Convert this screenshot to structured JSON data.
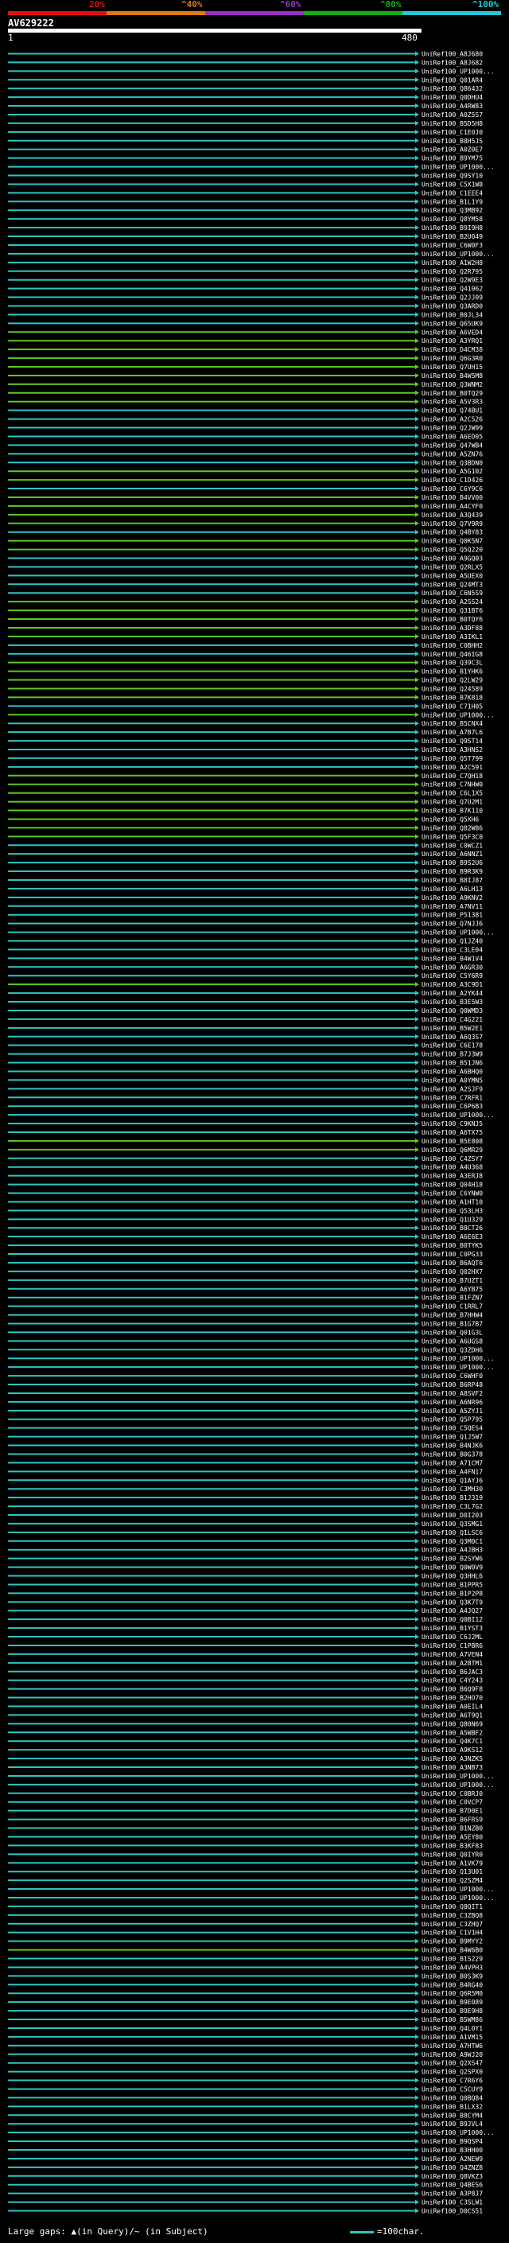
{
  "header": {
    "scale_labels": [
      "20%",
      "^40%",
      "^60%",
      "^80%",
      "^100%"
    ],
    "scale_colors": [
      "#e01010",
      "#e07810",
      "#9a30c8",
      "#10b010",
      "#20c8d8"
    ],
    "query_name": "AV629222",
    "query_start": "1",
    "query_end": "480"
  },
  "footer": {
    "legend_text": "Large gaps: ▲(in Query)/~ (in Subject)",
    "key_text": "=100char."
  },
  "colors": {
    "cyan": "#2ec4c4",
    "green": "#5cc820"
  },
  "chart_data": {
    "type": "alignment-hit-map",
    "query_length": 480,
    "hit_ids": [
      "UniRef100_A8J680",
      "UniRef100_A8J682",
      "UniRef100_UP1000...",
      "UniRef100_Q01AR4",
      "UniRef100_Q86432",
      "UniRef100_Q0DHU4",
      "UniRef100_A4RW83",
      "UniRef100_A0Z5S7",
      "UniRef100_B5D5H8",
      "UniRef100_C1E0J0",
      "UniRef100_B8H5J5",
      "UniRef100_A0Z0E7",
      "UniRef100_B9YM75",
      "UniRef100_UP1000...",
      "UniRef100_Q9SY10",
      "UniRef100_C5X1W8",
      "UniRef100_C1EEE4",
      "UniRef100_B1L1Y9",
      "UniRef100_Q3MB92",
      "UniRef100_Q8YM58",
      "UniRef100_B9I9H8",
      "UniRef100_B2U049",
      "UniRef100_C6W0F3",
      "UniRef100_UP1000...",
      "UniRef100_A1W2H8",
      "UniRef100_Q2R795",
      "UniRef100_Q2W9E3",
      "UniRef100_Q41062",
      "UniRef100_Q2JJ09",
      "UniRef100_Q3ARD0",
      "UniRef100_B0JL34",
      "UniRef100_Q65UK9",
      "UniRef100_A6VED4",
      "UniRef100_A3YRQ1",
      "UniRef100_D4CM38",
      "UniRef100_Q6G3R0",
      "UniRef100_Q7UH15",
      "UniRef100_B4W5M8",
      "UniRef100_Q3WNM2",
      "UniRef100_B0TQ29",
      "UniRef100_A5V3R3",
      "UniRef100_Q74BU1",
      "UniRef100_A2C526",
      "UniRef100_Q2JW99",
      "UniRef100_A6ED05",
      "UniRef100_Q47WB4",
      "UniRef100_A5ZN76",
      "UniRef100_Q3BDN0",
      "UniRef100_A5G102",
      "UniRef100_C1D426",
      "UniRef100_C6Y9C6",
      "UniRef100_B4VV00",
      "UniRef100_A4CYF0",
      "UniRef100_A3Q439",
      "UniRef100_Q7V9R9",
      "UniRef100_Q4BY83",
      "UniRef100_Q0K5N7",
      "UniRef100_Q5Q220",
      "UniRef100_A9GQ03",
      "UniRef100_Q2RLX5",
      "UniRef100_A5UEX0",
      "UniRef100_Q24MT3",
      "UniRef100_C6N5S9",
      "UniRef100_A2SS24",
      "UniRef100_Q31BT6",
      "UniRef100_B0TQY6",
      "UniRef100_A3DF88",
      "UniRef100_A3IKL1",
      "UniRef100_C0BHH2",
      "UniRef100_Q46IG8",
      "UniRef100_Q39C3L",
      "UniRef100_B1YHK6",
      "UniRef100_Q2LW29",
      "UniRef100_Q24589",
      "UniRef100_B7K818",
      "UniRef100_C71H05",
      "UniRef100_UP1000...",
      "UniRef100_B5CNX4",
      "UniRef100_A7B7L6",
      "UniRef100_Q9ST14",
      "UniRef100_A3HNS2",
      "UniRef100_Q5T799",
      "UniRef100_A2C591",
      "UniRef100_C7QH18",
      "UniRef100_C7NHW0",
      "UniRef100_C6L1X5",
      "UniRef100_Q7U2M1",
      "UniRef100_B7K110",
      "UniRef100_Q5XH6",
      "UniRef100_Q82W86",
      "UniRef100_Q5F3C0",
      "UniRef100_C0WCZ1",
      "UniRef100_A6NNZ1",
      "UniRef100_B9S2U6",
      "UniRef100_B9R3K9",
      "UniRef100_B8IJ87",
      "UniRef100_A6LH13",
      "UniRef100_A9KNV2",
      "UniRef100_A7NV11",
      "UniRef100_P51381",
      "UniRef100_Q7NJJ6",
      "UniRef100_UP1000...",
      "UniRef100_Q1JZ40",
      "UniRef100_C3LE04",
      "UniRef100_B4W1V4",
      "UniRef100_A6GR30",
      "UniRef100_C5Y6R9",
      "UniRef100_A3C9D1",
      "UniRef100_A2YK44",
      "UniRef100_B3E5W3",
      "UniRef100_Q0WMD3",
      "UniRef100_C4G221",
      "UniRef100_B5W2E1",
      "UniRef100_A6Q3S7",
      "UniRef100_C6E178",
      "UniRef100_B7J3W9",
      "UniRef100_B51JN6",
      "UniRef100_A6BHQ0",
      "UniRef100_A0YMN5",
      "UniRef100_A2SJF9",
      "UniRef100_C7RFR1",
      "UniRef100_C6P6B3",
      "UniRef100_UP1000...",
      "UniRef100_C9KNJ5",
      "UniRef100_A6TX75",
      "UniRef100_B5E808",
      "UniRef100_Q6MR29",
      "UniRef100_C4ZSY7",
      "UniRef100_A4U368",
      "UniRef100_A3ERJ8",
      "UniRef100_Q04H18",
      "UniRef100_C6YNW0",
      "UniRef100_A1HT10",
      "UniRef100_Q53LH3",
      "UniRef100_Q1U329",
      "UniRef100_B8CT26",
      "UniRef100_A6E6E3",
      "UniRef100_B0TYK5",
      "UniRef100_C0PG33",
      "UniRef100_B6AQT6",
      "UniRef100_Q02HX7",
      "UniRef100_B7UZT1",
      "UniRef100_A6YB75",
      "UniRef100_B1FZN7",
      "UniRef100_C1RRL7",
      "UniRef100_B7HHW4",
      "UniRef100_B1G7B7",
      "UniRef100_Q01G3L",
      "UniRef100_A6UGS8",
      "UniRef100_Q3ZDH6",
      "UniRef100_UP1000...",
      "UniRef100_UP1000...",
      "UniRef100_C6WHF0",
      "UniRef100_B6RP48",
      "UniRef100_A8SVF2",
      "UniRef100_A6NR96",
      "UniRef100_A5ZYJ1",
      "UniRef100_Q5P795",
      "UniRef100_C5QES4",
      "UniRef100_Q1J5W7",
      "UniRef100_B4NJK6",
      "UniRef100_B0G378",
      "UniRef100_A71CM7",
      "UniRef100_A4FN17",
      "UniRef100_Q1AYJ6",
      "UniRef100_C3MH30",
      "UniRef100_B1J319",
      "UniRef100_C3L7G2",
      "UniRef100_D0I203",
      "UniRef100_Q3SMG1",
      "UniRef100_Q1LSC6",
      "UniRef100_Q3M0C1",
      "UniRef100_A4JBH3",
      "UniRef100_B2SYW6",
      "UniRef100_Q0W0V9",
      "UniRef100_Q3HHL6",
      "UniRef100_B1PPR5",
      "UniRef100_B1P2P8",
      "UniRef100_Q3K7T9",
      "UniRef100_A4JQ27",
      "UniRef100_Q0BI12",
      "UniRef100_B1YST3",
      "UniRef100_C6J2ML",
      "UniRef100_C1P8R6",
      "UniRef100_A7VEN4",
      "UniRef100_A2BTM1",
      "UniRef100_B6JAC3",
      "UniRef100_C4Y243",
      "UniRef100_B6Q9F8",
      "UniRef100_B2HO70",
      "UniRef100_A0EIL4",
      "UniRef100_A6T9Q1",
      "UniRef100_Q80N69",
      "UniRef100_A5WBF2",
      "UniRef100_Q4K7C1",
      "UniRef100_A9KS12",
      "UniRef100_A3NZK5",
      "UniRef100_A3NB73",
      "UniRef100_UP1000...",
      "UniRef100_UP1000...",
      "UniRef100_C0BRJ0",
      "UniRef100_C0VCP7",
      "UniRef100_B7D0E1",
      "UniRef100_B6FRS9",
      "UniRef100_B1NZB0",
      "UniRef100_A5EY80",
      "UniRef100_B3KF83",
      "UniRef100_Q0IYR0",
      "UniRef100_A1VK79",
      "UniRef100_Q13U01",
      "UniRef100_Q2SZM4",
      "UniRef100_UP1000...",
      "UniRef100_UP1000...",
      "UniRef100_Q8QIT1",
      "UniRef100_C3ZBQ8",
      "UniRef100_C3ZHQ7",
      "UniRef100_C1V1H4",
      "UniRef100_B9MYY2",
      "UniRef100_B4W6B0",
      "UniRef100_B1S229",
      "UniRef100_A4VPH3",
      "UniRef100_B0S3K9",
      "UniRef100_B4RG40",
      "UniRef100_Q6R5M0",
      "UniRef100_B9E089",
      "UniRef100_B9E9H8",
      "UniRef100_B5WM86",
      "UniRef100_Q4L0Y1",
      "UniRef100_A1VM15",
      "UniRef100_A7HTW6",
      "UniRef100_A9WJ20",
      "UniRef100_Q2XS47",
      "UniRef100_Q2SPX0",
      "UniRef100_C7R6Y6",
      "UniRef100_C5CUY9",
      "UniRef100_Q0BQ84",
      "UniRef100_B1LX32",
      "UniRef100_B8CYM4",
      "UniRef100_B9JVL4",
      "UniRef100_UP1000...",
      "UniRef100_B9QSP4",
      "UniRef100_B3HH00",
      "UniRef100_A2NEW9",
      "UniRef100_Q4ZNZ8",
      "UniRef100_Q8VKZ3",
      "UniRef100_Q4BES6",
      "UniRef100_A3P8J7",
      "UniRef100_C3SLW1",
      "UniRef100_D0CS51"
    ],
    "green_rows": [
      32,
      33,
      34,
      35,
      36,
      37,
      38,
      39,
      40,
      48,
      49,
      51,
      52,
      53,
      54,
      56,
      57,
      63,
      64,
      65,
      66,
      67,
      70,
      71,
      72,
      73,
      74,
      76,
      83,
      84,
      85,
      86,
      87,
      88,
      89,
      90,
      107,
      125,
      126,
      218,
      262,
      263,
      264,
      265,
      266,
      267,
      268,
      269,
      270
    ]
  }
}
